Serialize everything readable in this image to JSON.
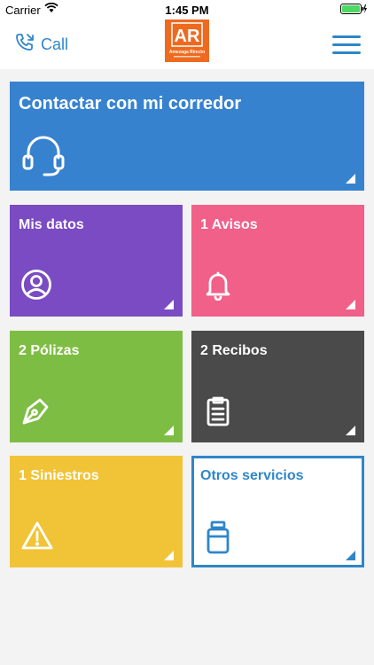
{
  "status_bar": {
    "carrier": "Carrier",
    "time": "1:45 PM"
  },
  "header": {
    "call_label": "Call",
    "logo_letters": "AR",
    "logo_subtitle": "Amezaga Rincón"
  },
  "tiles": {
    "contact": "Contactar con mi corredor",
    "datos": "Mis datos",
    "avisos": "1 Avisos",
    "polizas": "2 Pólizas",
    "recibos": "2 Recibos",
    "siniestros": "1 Siniestros",
    "otros": "Otros servicios"
  },
  "colors": {
    "accent": "#2f86c8",
    "contact": "#3782cf",
    "datos": "#7a4bc2",
    "avisos": "#f06089",
    "polizas": "#7ebd43",
    "recibos": "#4a4a4a",
    "siniestros": "#f1c337",
    "logo": "#ee6a1f"
  },
  "icons": {
    "contact": "headset-icon",
    "datos": "user-circle-icon",
    "avisos": "bell-icon",
    "polizas": "pen-nib-icon",
    "recibos": "clipboard-icon",
    "siniestros": "warning-icon",
    "otros": "jar-icon"
  }
}
